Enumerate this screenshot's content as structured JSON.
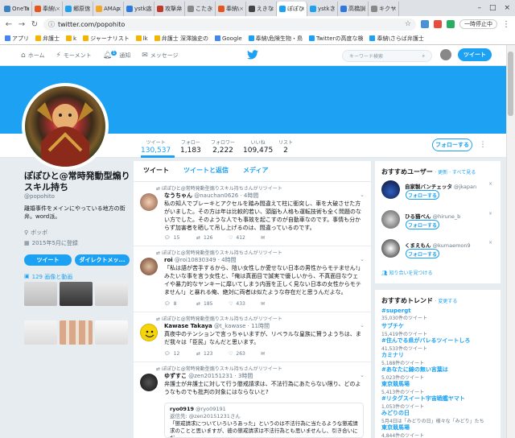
{
  "browser": {
    "tabs": [
      "OneTa",
      "奉納\\",
      "郷原信",
      "AMAp",
      "ystk応",
      "攻撃弁",
      "こたき",
      "奉納\\",
      "えきな",
      "ぽぽひ",
      "ystkさ",
      "高橋訓",
      "キクヤ"
    ],
    "active_tab_index": 9,
    "url": "twitter.com/popohito",
    "window_min": "–",
    "window_max": "□",
    "window_close": "×",
    "pause_label": "一時停止中"
  },
  "bookmarks": [
    "アプリ",
    "弁護士",
    "k",
    "ジャーナリスト",
    "lk",
    "弁護士 深澤論史の",
    "Google",
    "奉納\\危険生物・鳥",
    "Twitterの高度な検",
    "奉納\\さらば弁護士"
  ],
  "nav": {
    "home": "ホーム",
    "moments": "モーメント",
    "notifications": "通知",
    "notif_count": "1",
    "messages": "メッセージ",
    "search_placeholder": "キーワード検索",
    "tweet_button": "ツイート"
  },
  "stats": [
    {
      "label": "ツイート",
      "value": "130,537"
    },
    {
      "label": "フォロー",
      "value": "1,183"
    },
    {
      "label": "フォロワー",
      "value": "2,222"
    },
    {
      "label": "いいね",
      "value": "109,475"
    },
    {
      "label": "リスト",
      "value": "2"
    }
  ],
  "follow_button": "フォローする",
  "kebab": "⋮",
  "profile": {
    "name": "ぽぽひと@常時発動型煽りスキル持ち",
    "handle": "@popohito",
    "bio": "離婚事件をメインにやっている地方の街弁。word派。",
    "location": "ボッボ",
    "joined": "2015年5月に登録",
    "tweet_btn": "ツイート",
    "dm_btn": "ダイレクトメッ...",
    "photos_label": "129 画像と動画"
  },
  "timeline": {
    "tabs": [
      "ツイート",
      "ツイートと返信",
      "メディア"
    ],
    "tweets": [
      {
        "rt": "ぽぽひと@常時発動型煽りスキル持ちさんがリツイート",
        "name": "なうちゃん",
        "handle": "@nauchan0626 · 4時間",
        "text": "私の知人でブレーキとアクセルを踏み間違えて柱に衝突し、車を大破させた方がいました。その方は年は比較的若い、頭脳も人格も運転技術も全く問題のない方でした。そのような人でも事故を起こすのが自動車なのです。事情も分からず加害者を晒して吊し上げるのは、間違っているのです。",
        "replies": "15",
        "retweets": "126",
        "likes": "412"
      },
      {
        "rt": "ぽぽひと@常時発動型煽りスキル持ちさんがリツイート",
        "name": "roi",
        "handle": "@roi10830349 · 4時間",
        "text": "「私は語が苦手するから、陰い女性しか愛せない日本の男性からモテません!」みたいな事を言う女性と、「俺は真面目で誠実で優しいから、不真面目なウェイや暴力的なヤンキーに靡いてしまう内面を正しく見ない日本の女性からモテません!」と暴れる俺、絶対に両者は似たような存在だと思うんだよな。",
        "replies": "8",
        "retweets": "185",
        "likes": "433"
      },
      {
        "rt": "ぽぽひと@常時発動型煽りスキル持ちさんがリツイート",
        "name": "Kawase Takaya",
        "handle": "@t_kawase · 11時間",
        "text": "真夜中のテンションで言っちゃいますが、リベラルな皇族に賛うようちは、まだ我々は「臣民」なんだと思います。",
        "replies": "12",
        "retweets": "123",
        "likes": "263"
      },
      {
        "rt": "ぽぽひと@常時発動型煽りスキル持ちさんがリツイート",
        "name": "ゆずすこ",
        "handle": "@zen20151231 · 3時間",
        "text": "弁護士が弁護士に対して行う懲戒請求は、不法行為にあたらない限り、どのようなものでも批判の対象にはならないと?"
      }
    ],
    "quote": {
      "name": "ryo0919",
      "handle": "@ryo09191",
      "reply_to": "返信先: @zen20151231さん",
      "text": "「懲戒請求についていろいろあった」というのは不法行為に当たるような懲戒請求のことと思いますが、彼の懲戒請求は不法行為とも思いませんし、引き合いにだ"
    }
  },
  "who_to_follow": {
    "title": "おすすめユーザー",
    "refresh": "· 更新 · すべて見る",
    "follow_label": "フォローする",
    "users": [
      {
        "name": "自家製バンチェッタ",
        "handle": "@jkapan"
      },
      {
        "name": "ひる猫べん",
        "handle": "@hirune_b"
      },
      {
        "name": "くまえもん",
        "handle": "@kumaemon9"
      }
    ],
    "find_friends": "知り合いを見つける"
  },
  "trends": {
    "title": "おすすめトレンド",
    "change": "· 変更する",
    "items": [
      {
        "name": "#supergt",
        "count": "35,030件のツイート"
      },
      {
        "name": "サブチケ",
        "count": "15,419件のツイート"
      },
      {
        "name": "#住んでる県がバレるツイートしろ",
        "count": "41,533件のツイート"
      },
      {
        "name": "カミナリ",
        "count": "5,188件のツイート"
      },
      {
        "name": "#あなたに線の無い言葉は",
        "count": "5,023件のツイート"
      },
      {
        "name": "東京競馬場",
        "count": "5,413件のツイート"
      },
      {
        "name": "#リタグスイート宇宙戦艦ヤマト",
        "count": "1,053件のツイート"
      },
      {
        "name": "みどりの日",
        "count": "5月4日は「みどりの日」様々な「みどり」たち"
      },
      {
        "name": "東京競馬場",
        "count": "4,844件のツイート"
      }
    ]
  },
  "colors": {
    "accent": "#1da1f2",
    "banner": "#1da1f2"
  }
}
